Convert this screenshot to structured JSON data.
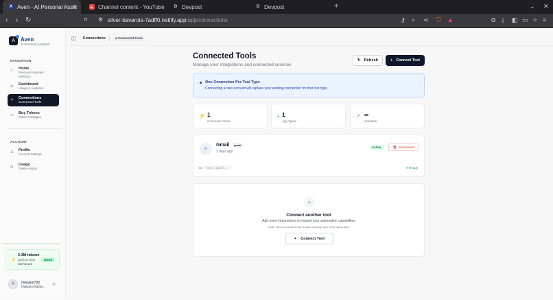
{
  "browser": {
    "tabs": [
      {
        "title": "Aven - AI Personal Assis",
        "fav": "A",
        "fav_color": "#1e3a8a"
      },
      {
        "title": "Channel content - YouTube",
        "fav": "▶",
        "fav_color": "#ef4444"
      },
      {
        "title": "Devpost",
        "fav": "D",
        "fav_color": "#2b2b2e"
      },
      {
        "title": "Devpost",
        "fav": "D",
        "fav_color": "#2b2b2e"
      }
    ],
    "url_host": "silver-bavarois-7adff0.netlify.app",
    "url_path": "/app/connections"
  },
  "sidebar": {
    "brand_name": "Aven",
    "brand_sub": "AI Personal Assistant",
    "nav_label": "NAVIGATION",
    "nav_items": [
      {
        "title": "Home",
        "sub": "Personal Assistant Interface",
        "icon": "home-icon"
      },
      {
        "title": "Dashboard",
        "sub": "Usage & Analytics",
        "icon": "chart-icon"
      },
      {
        "title": "Connections",
        "sub": "Connected Tools",
        "icon": "plug-icon"
      },
      {
        "title": "Buy Tokens",
        "sub": "Token Packages",
        "icon": "card-icon"
      }
    ],
    "account_label": "ACCOUNT",
    "account_items": [
      {
        "title": "Profile",
        "sub": "Account Settings",
        "icon": "user-icon"
      },
      {
        "title": "Usage",
        "sub": "Token History",
        "icon": "chart-icon"
      }
    ],
    "tokens": {
      "amount": "2.3M tokens",
      "sub": "Click to view dashboard",
      "badge": "Good"
    },
    "user": {
      "initial": "A",
      "name": "hiveyam793",
      "email": "hiveyam793@e..."
    }
  },
  "breadcrumb": {
    "page": "Connections",
    "current": "Connected Tools"
  },
  "header": {
    "title": "Connected Tools",
    "subtitle": "Manage your integrations and connected services",
    "refresh": "Refresh",
    "connect": "Connect Tool"
  },
  "info": {
    "title": "One Connection Per Tool Type",
    "text": "Connecting a new account will replace your existing connection for that tool type."
  },
  "stats": [
    {
      "value": "1",
      "label": "Connected Tools",
      "color": "#3b82f6",
      "icon": "⚡"
    },
    {
      "value": "1",
      "label": "App Types",
      "color": "#22c55e",
      "icon": "●"
    },
    {
      "value": "∞",
      "label": "Available",
      "color": "#a855f7",
      "icon": "↗"
    }
  ],
  "tool": {
    "name": "Gmail",
    "tag": "gmail",
    "ago": "3 days ago",
    "status": "Active",
    "disconnect": "Disconnect",
    "id_label": "ID:",
    "id_value": "test::gmail...",
    "ready": "Ready"
  },
  "add": {
    "title": "Connect another tool",
    "text": "Add more integrations to expand your automation capabilities",
    "note": "Note: New connections will replace existing ones of the same type",
    "button": "Connect Tool"
  }
}
